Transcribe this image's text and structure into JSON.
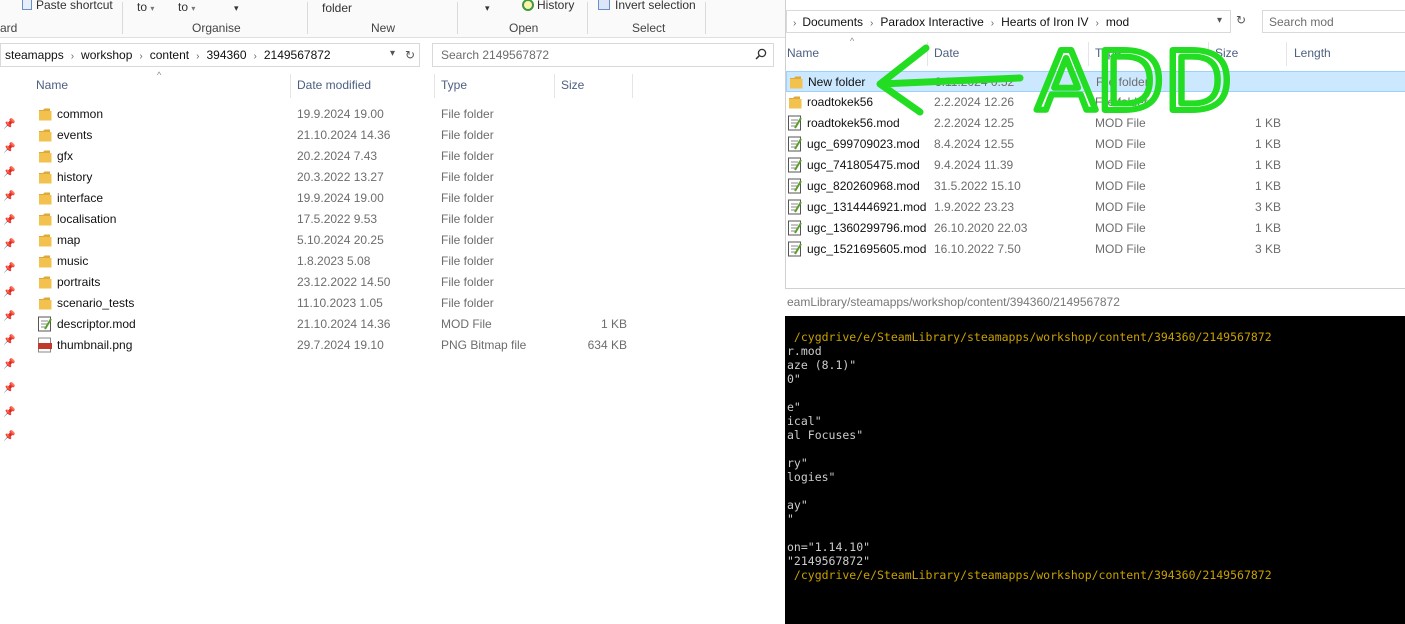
{
  "left_window": {
    "ribbon": {
      "clipboard_partial_label": "ard",
      "paste_shortcut_label": "Paste shortcut",
      "move_to_label": "to",
      "copy_to_label": "to",
      "organise_label": "Organise",
      "new_folder_label": "folder",
      "new_label": "New",
      "history_label": "History",
      "open_label": "Open",
      "invert_selection_label": "Invert selection",
      "select_label": "Select"
    },
    "address": [
      "steamapps",
      "workshop",
      "content",
      "394360",
      "2149567872"
    ],
    "search_placeholder": "Search 2149567872",
    "columns": [
      "Name",
      "Date modified",
      "Type",
      "Size"
    ],
    "files": [
      {
        "name": "common",
        "date": "19.9.2024 19.00",
        "type": "File folder",
        "size": "",
        "icon": "folder"
      },
      {
        "name": "events",
        "date": "21.10.2024 14.36",
        "type": "File folder",
        "size": "",
        "icon": "folder"
      },
      {
        "name": "gfx",
        "date": "20.2.2024 7.43",
        "type": "File folder",
        "size": "",
        "icon": "folder"
      },
      {
        "name": "history",
        "date": "20.3.2022 13.27",
        "type": "File folder",
        "size": "",
        "icon": "folder"
      },
      {
        "name": "interface",
        "date": "19.9.2024 19.00",
        "type": "File folder",
        "size": "",
        "icon": "folder"
      },
      {
        "name": "localisation",
        "date": "17.5.2022 9.53",
        "type": "File folder",
        "size": "",
        "icon": "folder"
      },
      {
        "name": "map",
        "date": "5.10.2024 20.25",
        "type": "File folder",
        "size": "",
        "icon": "folder"
      },
      {
        "name": "music",
        "date": "1.8.2023 5.08",
        "type": "File folder",
        "size": "",
        "icon": "folder"
      },
      {
        "name": "portraits",
        "date": "23.12.2022 14.50",
        "type": "File folder",
        "size": "",
        "icon": "folder"
      },
      {
        "name": "scenario_tests",
        "date": "11.10.2023 1.05",
        "type": "File folder",
        "size": "",
        "icon": "folder"
      },
      {
        "name": "descriptor.mod",
        "date": "21.10.2024 14.36",
        "type": "MOD File",
        "size": "1 KB",
        "icon": "mod-file"
      },
      {
        "name": "thumbnail.png",
        "date": "29.7.2024 19.10",
        "type": "PNG Bitmap file",
        "size": "634 KB",
        "icon": "png-file"
      }
    ]
  },
  "right_window": {
    "address": [
      "Documents",
      "Paradox Interactive",
      "Hearts of Iron IV",
      "mod"
    ],
    "search_placeholder": "Search mod",
    "columns": [
      "Name",
      "Date",
      "Type",
      "Size",
      "Length"
    ],
    "files": [
      {
        "name": "New folder",
        "date": "3.11.2024 0.52",
        "type": "File folder",
        "size": "",
        "icon": "folder",
        "selected": true
      },
      {
        "name": "roadtokek56",
        "date": "2.2.2024 12.26",
        "type": "File folder",
        "size": "",
        "icon": "folder",
        "selected": false
      },
      {
        "name": "roadtokek56.mod",
        "date": "2.2.2024 12.25",
        "type": "MOD File",
        "size": "1 KB",
        "icon": "mod-file",
        "selected": false
      },
      {
        "name": "ugc_699709023.mod",
        "date": "8.4.2024 12.55",
        "type": "MOD File",
        "size": "1 KB",
        "icon": "mod-file",
        "selected": false
      },
      {
        "name": "ugc_741805475.mod",
        "date": "9.4.2024 11.39",
        "type": "MOD File",
        "size": "1 KB",
        "icon": "mod-file",
        "selected": false
      },
      {
        "name": "ugc_820260968.mod",
        "date": "31.5.2022 15.10",
        "type": "MOD File",
        "size": "1 KB",
        "icon": "mod-file",
        "selected": false
      },
      {
        "name": "ugc_1314446921.mod",
        "date": "1.9.2022 23.23",
        "type": "MOD File",
        "size": "3 KB",
        "icon": "mod-file",
        "selected": false
      },
      {
        "name": "ugc_1360299796.mod",
        "date": "26.10.2020 22.03",
        "type": "MOD File",
        "size": "1 KB",
        "icon": "mod-file",
        "selected": false
      },
      {
        "name": "ugc_1521695605.mod",
        "date": "16.10.2022 7.50",
        "type": "MOD File",
        "size": "3 KB",
        "icon": "mod-file",
        "selected": false
      }
    ]
  },
  "terminal": {
    "title": "eamLibrary/steamapps/workshop/content/394360/2149567872",
    "lines": [
      {
        "text": " /cygdrive/e/SteamLibrary/steamapps/workshop/content/394360/2149567872",
        "kind": "prompt"
      },
      {
        "text": "r.mod",
        "kind": "out"
      },
      {
        "text": "aze (8.1)\"",
        "kind": "out"
      },
      {
        "text": "0\"",
        "kind": "out"
      },
      {
        "text": "",
        "kind": "out"
      },
      {
        "text": "e\"",
        "kind": "out"
      },
      {
        "text": "ical\"",
        "kind": "out"
      },
      {
        "text": "al Focuses\"",
        "kind": "out"
      },
      {
        "text": "",
        "kind": "out"
      },
      {
        "text": "ry\"",
        "kind": "out"
      },
      {
        "text": "logies\"",
        "kind": "out"
      },
      {
        "text": "",
        "kind": "out"
      },
      {
        "text": "ay\"",
        "kind": "out"
      },
      {
        "text": "\"",
        "kind": "out"
      },
      {
        "text": "",
        "kind": "out"
      },
      {
        "text": "on=\"1.14.10\"",
        "kind": "out"
      },
      {
        "text": "\"2149567872\"",
        "kind": "out"
      },
      {
        "text": " /cygdrive/e/SteamLibrary/steamapps/workshop/content/394360/2149567872",
        "kind": "prompt"
      }
    ]
  },
  "annotation": {
    "text": "ADD",
    "color": "#22dd22"
  },
  "colors": {
    "folder": "#f2c14e",
    "folder_dark": "#dca93a",
    "selection": "#cce8ff",
    "header_text": "#4d6082",
    "terminal_prompt": "#c8a000"
  }
}
